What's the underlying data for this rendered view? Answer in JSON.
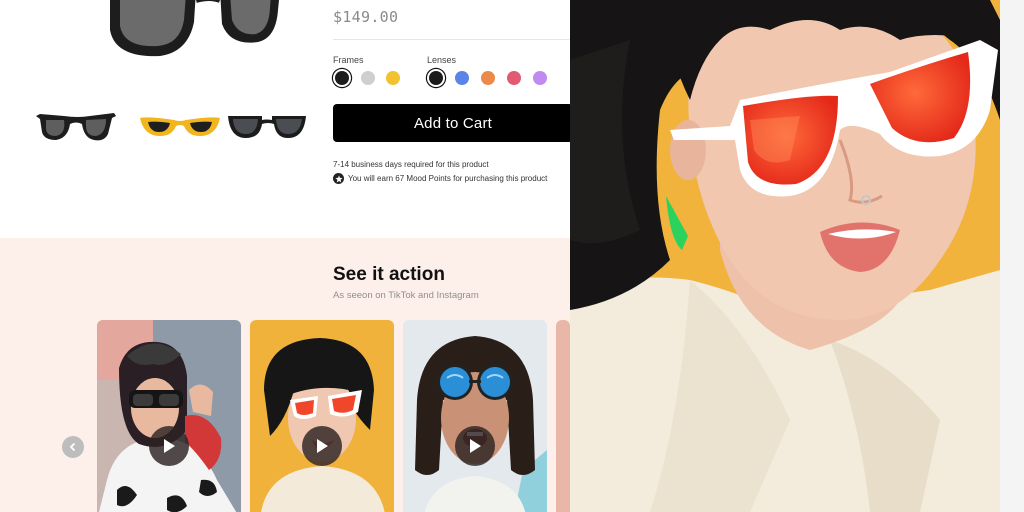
{
  "product": {
    "price": "$149.00",
    "frames_label": "Frames",
    "lenses_label": "Lenses",
    "frame_swatches": [
      {
        "color": "#1c1c1c",
        "selected": true
      },
      {
        "color": "#cfcfcf",
        "selected": false
      },
      {
        "color": "#f2c230",
        "selected": false
      }
    ],
    "lens_swatches": [
      {
        "color": "#1c1c1c",
        "selected": true
      },
      {
        "color": "#5b84e8",
        "selected": false
      },
      {
        "color": "#ec8a4a",
        "selected": false
      },
      {
        "color": "#e25a72",
        "selected": false
      },
      {
        "color": "#c18af0",
        "selected": false
      }
    ],
    "add_to_cart_label": "Add to Cart",
    "shipping_note": "7-14 business days required for this product",
    "points_note": "You will earn 67 Mood Points for purchasing this product",
    "thumbnails": [
      "black-square-sunglasses",
      "yellow-cat-eye-sunglasses",
      "black-tinted-sunglasses"
    ]
  },
  "action_section": {
    "title": "See it action",
    "subtitle": "As seeon on TikTok and Instagram",
    "videos": [
      {
        "name": "woman-cow-print-black-sunglasses"
      },
      {
        "name": "woman-white-frame-red-lens"
      },
      {
        "name": "woman-blue-mirror-round-sunglasses"
      }
    ]
  },
  "colors": {
    "accent": "#000000",
    "section_bg": "#fdf0ea",
    "hero_bg": "#f1b33c"
  }
}
